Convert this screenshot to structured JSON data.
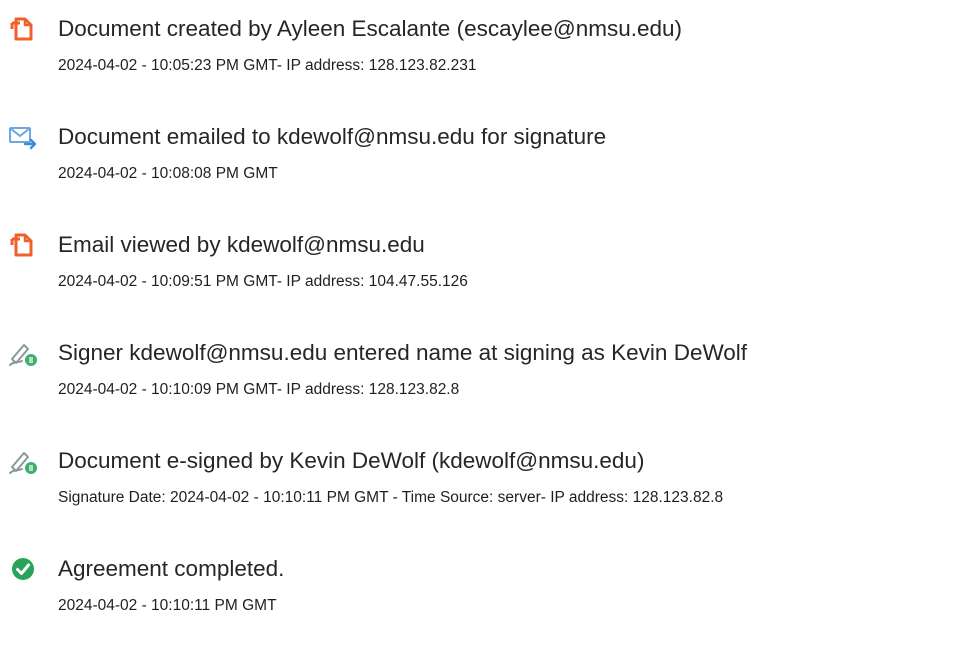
{
  "colors": {
    "document_icon": "#f0602a",
    "email_icon": "#3a8fd8",
    "signer_icon": "#8a9a9a",
    "signer_badge": "#3fae6e",
    "check_icon": "#2aa35a"
  },
  "events": [
    {
      "icon": "document-icon",
      "title": "Document created by Ayleen Escalante (escaylee@nmsu.edu)",
      "detail": "2024-04-02 - 10:05:23 PM GMT- IP address: 128.123.82.231"
    },
    {
      "icon": "email-sent-icon",
      "title": "Document emailed to kdewolf@nmsu.edu for signature",
      "detail": "2024-04-02 - 10:08:08 PM GMT"
    },
    {
      "icon": "document-icon",
      "title": "Email viewed by kdewolf@nmsu.edu",
      "detail": "2024-04-02 - 10:09:51 PM GMT- IP address: 104.47.55.126"
    },
    {
      "icon": "pen-signature-icon",
      "title": "Signer kdewolf@nmsu.edu entered name at signing as Kevin DeWolf",
      "detail": "2024-04-02 - 10:10:09 PM GMT- IP address: 128.123.82.8"
    },
    {
      "icon": "pen-signature-icon",
      "title": "Document e-signed by Kevin DeWolf (kdewolf@nmsu.edu)",
      "detail": "Signature Date: 2024-04-02 - 10:10:11 PM GMT - Time Source: server- IP address: 128.123.82.8"
    },
    {
      "icon": "check-circle-icon",
      "title": "Agreement completed.",
      "detail": "2024-04-02 - 10:10:11 PM GMT"
    }
  ]
}
